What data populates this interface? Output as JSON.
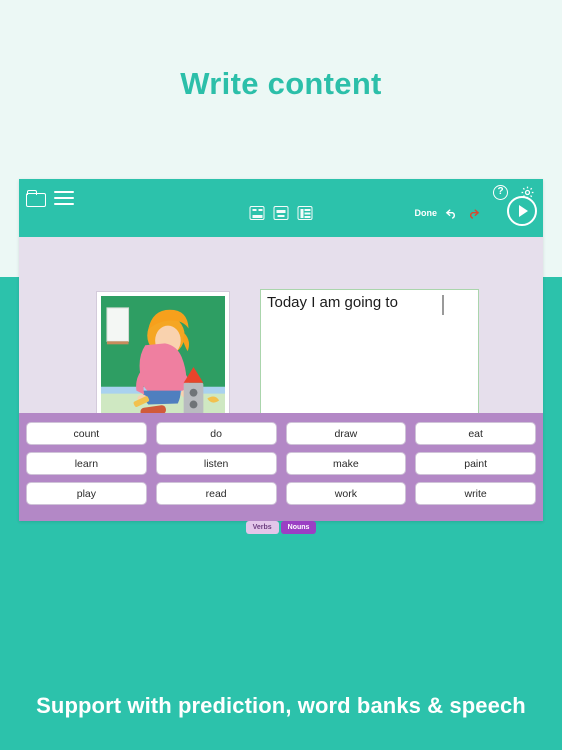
{
  "page": {
    "headline": "Write content",
    "caption": "Support with prediction, word banks & speech",
    "bg_light": "#ecf8f5",
    "teal": "#2cc2ab",
    "accent": "#2cbfa9"
  },
  "app": {
    "header": {
      "folder_icon": "folder-icon",
      "menu_icon": "hamburger-menu-icon",
      "view_icons": [
        "grid-view-icon",
        "keyboard-view-icon",
        "list-view-icon"
      ],
      "help_icon": "help-icon",
      "help_glyph": "?",
      "settings_icon": "gear-icon",
      "done_label": "Done",
      "undo_icon": "undo-icon",
      "redo_icon": "redo-icon",
      "play_icon": "play-icon"
    },
    "editor": {
      "text": "Today I am going to ",
      "border_color": "#aad5ac",
      "keys": [
        {
          "name": "backspace-key",
          "glyph": "⌫",
          "color": "#d94a4a"
        },
        {
          "name": "enter-key",
          "glyph": "↵",
          "color": "#f07a2a"
        },
        {
          "name": "speak-key",
          "glyph": "ǁ",
          "color": "#2f7ec4"
        },
        {
          "name": "keyboard-key",
          "glyph": "⌨",
          "color": "#5faa3c"
        },
        {
          "name": "hide-keyboard-key",
          "glyph": "▽",
          "color": "#8a8a8a"
        }
      ]
    },
    "illustration": {
      "alt": "girl-making-cardboard-rocket-illustration"
    },
    "wordbank": {
      "bg": "#b388c6",
      "words": [
        "count",
        "do",
        "draw",
        "eat",
        "learn",
        "listen",
        "make",
        "paint",
        "play",
        "read",
        "work",
        "write"
      ]
    },
    "tabs": [
      {
        "label": "Verbs",
        "active": true
      },
      {
        "label": "Nouns",
        "active": false
      }
    ]
  }
}
